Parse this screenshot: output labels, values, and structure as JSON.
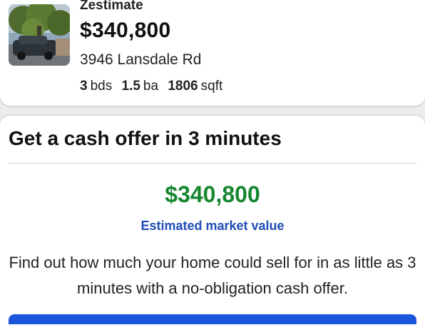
{
  "property_card": {
    "label": "Zestimate",
    "value": "$340,800",
    "address": "3946 Lansdale Rd",
    "beds_value": "3",
    "beds_unit": "bds",
    "baths_value": "1.5",
    "baths_unit": "ba",
    "sqft_value": "1806",
    "sqft_unit": "sqft",
    "thumbnail_icon": "house-photo"
  },
  "cash_offer": {
    "title": "Get a cash offer in 3 minutes",
    "value": "$340,800",
    "subtitle": "Estimated market value",
    "description": "Find out how much your home could sell for in as little as 3 minutes with a no-obligation cash offer."
  },
  "colors": {
    "offer_value": "#15872f",
    "subtitle": "#1f4db5",
    "cta": "#1a56db"
  }
}
